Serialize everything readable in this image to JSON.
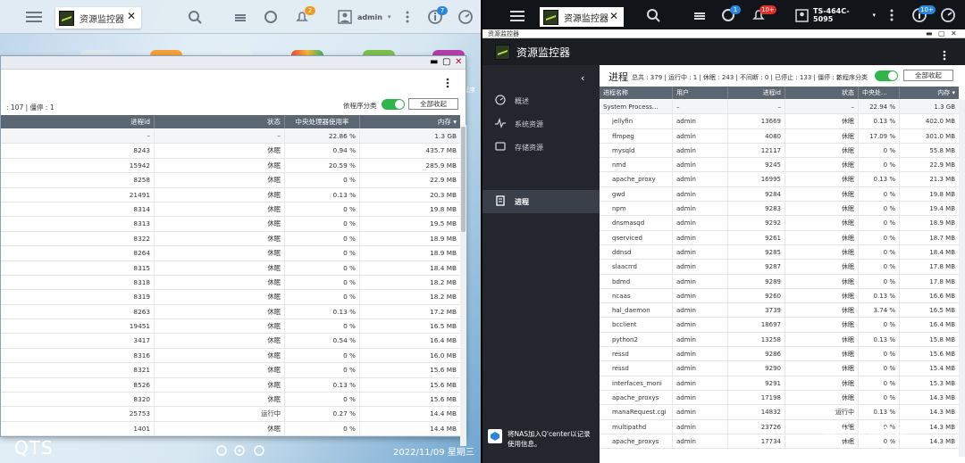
{
  "left": {
    "taskbar": {
      "app_tab_label": "资源监控器",
      "notification_badge": "2",
      "user_label": "admin",
      "info_badge": "7"
    },
    "window": {
      "summary": ": 107 | 僵停 : 1",
      "group_label": "依程序分类",
      "collapse_all_label": "全部收起",
      "columns": [
        "进程id",
        "状态",
        "中央处理器使用率",
        "内存"
      ],
      "rows": [
        [
          "–",
          "–",
          "22.86 %",
          "1.3 GB"
        ],
        [
          "8243",
          "休眠",
          "0.94 %",
          "435.7 MB"
        ],
        [
          "15942",
          "休眠",
          "20.59 %",
          "285.9 MB"
        ],
        [
          "8258",
          "休眠",
          "0 %",
          "22.9 MB"
        ],
        [
          "21491",
          "休眠",
          "0.13 %",
          "20.3 MB"
        ],
        [
          "8314",
          "休眠",
          "0 %",
          "19.8 MB"
        ],
        [
          "8313",
          "休眠",
          "0 %",
          "19.5 MB"
        ],
        [
          "8322",
          "休眠",
          "0 %",
          "18.9 MB"
        ],
        [
          "8264",
          "休眠",
          "0 %",
          "18.9 MB"
        ],
        [
          "8315",
          "休眠",
          "0 %",
          "18.4 MB"
        ],
        [
          "8318",
          "休眠",
          "0 %",
          "18.2 MB"
        ],
        [
          "8319",
          "休眠",
          "0 %",
          "18.2 MB"
        ],
        [
          "8263",
          "休眠",
          "0.13 %",
          "17.2 MB"
        ],
        [
          "19451",
          "休眠",
          "0 %",
          "16.5 MB"
        ],
        [
          "3417",
          "休眠",
          "0.54 %",
          "16.4 MB"
        ],
        [
          "8316",
          "休眠",
          "0 %",
          "16.0 MB"
        ],
        [
          "8321",
          "休眠",
          "0 %",
          "15.6 MB"
        ],
        [
          "8526",
          "休眠",
          "0.13 %",
          "15.6 MB"
        ],
        [
          "8320",
          "休眠",
          "0 %",
          "15.6 MB"
        ],
        [
          "25753",
          "运行中",
          "0.27 %",
          "14.4 MB"
        ],
        [
          "1401",
          "休眠",
          "0 %",
          "14.4 MB"
        ]
      ]
    },
    "desktop": {
      "brand": "QTS",
      "datetime": "2022/11/09 星期三",
      "edge_label": "程序"
    }
  },
  "right": {
    "taskbar": {
      "app_tab_label": "资源监控器",
      "task_badge": "1",
      "notification_badge": "10+",
      "device_label": "TS-464C-5095",
      "info_badge": "10+"
    },
    "window": {
      "caption": "资源监控器",
      "header_title": "资源监控器",
      "sidebar": [
        {
          "label": "概述",
          "icon": "gauge-icon"
        },
        {
          "label": "系统资源",
          "icon": "pulse-icon"
        },
        {
          "label": "存储资源",
          "icon": "storage-icon"
        },
        {
          "label": "进程",
          "icon": "process-icon"
        }
      ],
      "footer_text": "将NAS加入Q'center以记录使用信息。",
      "section_title": "进程",
      "summary": "总共 : 379 | 运行中 : 1 | 休眠 : 243 | 不间断 : 0 | 已停止 : 133 | 僵停 : 2",
      "group_label": "依程序分类",
      "collapse_all_label": "全部收起",
      "columns": [
        "进程名称",
        "用户",
        "进程id",
        "状态",
        "中央处...",
        "内存"
      ],
      "rows": [
        [
          "System Process...",
          "–",
          "–",
          "–",
          "22.94 %",
          "1.3 GB"
        ],
        [
          "jellyfin",
          "admin",
          "13669",
          "休眠",
          "0.13 %",
          "402.0 MB"
        ],
        [
          "ffmpeg",
          "admin",
          "4080",
          "休眠",
          "17.09 %",
          "301.0 MB"
        ],
        [
          "mysqld",
          "admin",
          "12117",
          "休眠",
          "0 %",
          "55.8 MB"
        ],
        [
          "nmd",
          "admin",
          "9245",
          "休眠",
          "0 %",
          "22.9 MB"
        ],
        [
          "apache_proxy",
          "admin",
          "16995",
          "休眠",
          "0.13 %",
          "21.3 MB"
        ],
        [
          "gwd",
          "admin",
          "9284",
          "休眠",
          "0 %",
          "19.8 MB"
        ],
        [
          "npm",
          "admin",
          "9283",
          "休眠",
          "0 %",
          "19.4 MB"
        ],
        [
          "dnsmasqd",
          "admin",
          "9292",
          "休眠",
          "0 %",
          "18.9 MB"
        ],
        [
          "qserviced",
          "admin",
          "9261",
          "休眠",
          "0 %",
          "18.7 MB"
        ],
        [
          "ddnsd",
          "admin",
          "9285",
          "休眠",
          "0 %",
          "18.4 MB"
        ],
        [
          "slaacrrd",
          "admin",
          "9287",
          "休眠",
          "0 %",
          "17.8 MB"
        ],
        [
          "bdmd",
          "admin",
          "9289",
          "休眠",
          "0 %",
          "17.8 MB"
        ],
        [
          "ncaas",
          "admin",
          "9260",
          "休眠",
          "0.13 %",
          "16.6 MB"
        ],
        [
          "hal_daemon",
          "admin",
          "3739",
          "休眠",
          "3.74 %",
          "16.5 MB"
        ],
        [
          "bcclient",
          "admin",
          "18697",
          "休眠",
          "0 %",
          "16.4 MB"
        ],
        [
          "python2",
          "admin",
          "13258",
          "休眠",
          "0.13 %",
          "15.8 MB"
        ],
        [
          "ressd",
          "admin",
          "9286",
          "休眠",
          "0 %",
          "15.6 MB"
        ],
        [
          "ressd",
          "admin",
          "9290",
          "休眠",
          "0 %",
          "15.4 MB"
        ],
        [
          "interfaces_moni",
          "admin",
          "9291",
          "休眠",
          "0 %",
          "15.3 MB"
        ],
        [
          "apache_proxys",
          "admin",
          "17198",
          "休眠",
          "0 %",
          "14.3 MB"
        ],
        [
          "manaRequest.cgi",
          "admin",
          "14832",
          "运行中",
          "0.13 %",
          "14.3 MB"
        ],
        [
          "multipathd",
          "admin",
          "23726",
          "休眠",
          "0 %",
          "14.3 MB"
        ],
        [
          "apache_proxys",
          "admin",
          "17734",
          "休眠",
          "0 %",
          "14.3 MB"
        ]
      ]
    }
  },
  "watermark": "值 什么值得买",
  "colors": {
    "toggle_on": "#2fb54a",
    "badge_blue": "#2b86d9",
    "badge_orange": "#f29c1f",
    "badge_red": "#e0302a"
  }
}
